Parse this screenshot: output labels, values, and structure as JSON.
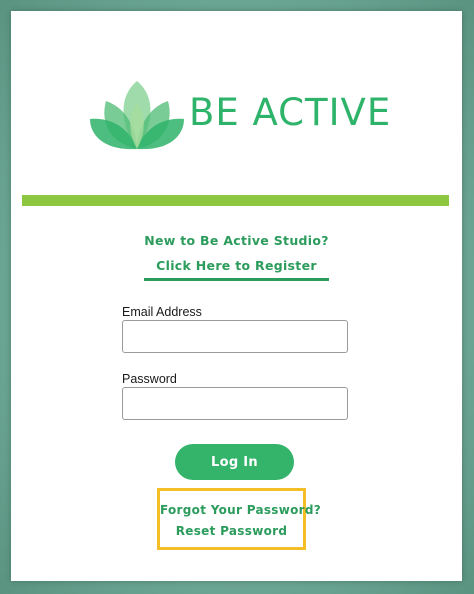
{
  "brand": {
    "name": "BE ACTIVE",
    "logo_icon": "lotus-icon",
    "color": "#2eb36a"
  },
  "divider": {
    "color": "#8dc63f"
  },
  "register": {
    "prompt": "New to Be Active Studio?",
    "link_label": "Click Here to Register"
  },
  "form": {
    "email_label": "Email Address",
    "email_value": "",
    "password_label": "Password",
    "password_value": "",
    "login_label": "Log In"
  },
  "reset": {
    "prompt": "Forgot Your Password?",
    "link_label": "Reset Password",
    "highlight_color": "#f4be26"
  },
  "colors": {
    "accent": "#34b36b",
    "link": "#2c9c5c",
    "background": "#6aa492"
  }
}
